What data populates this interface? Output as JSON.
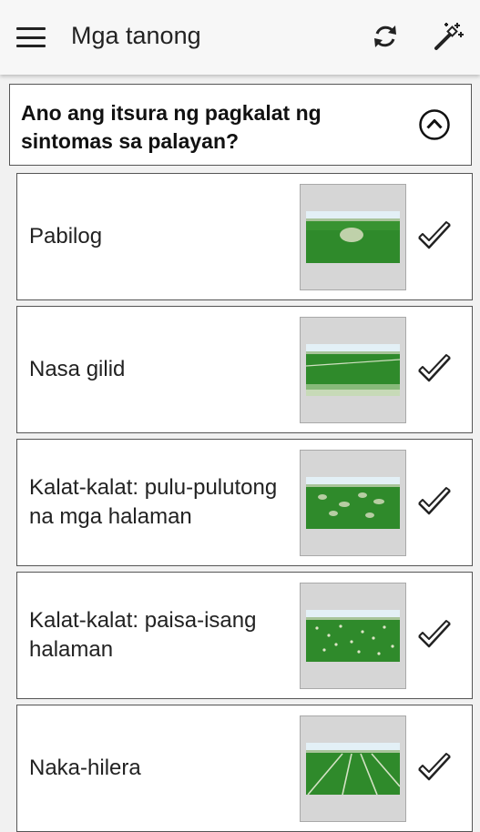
{
  "header": {
    "title": "Mga tanong"
  },
  "question": {
    "text": "Ano ang itsura ng pagkalat ng sintomas sa palayan?"
  },
  "options": [
    {
      "label": "Pabilog",
      "icon": "check-icon"
    },
    {
      "label": "Nasa gilid",
      "icon": "check-icon"
    },
    {
      "label": "Kalat-kalat: pulu-pulutong na mga halaman",
      "icon": "check-icon"
    },
    {
      "label": "Kalat-kalat: paisa-isang halaman",
      "icon": "check-icon"
    },
    {
      "label": "Naka-hilera",
      "icon": "check-icon"
    }
  ],
  "colors": {
    "field_green": "#2e8a2a",
    "sky": "#dfeef5",
    "outline": "#555555"
  }
}
